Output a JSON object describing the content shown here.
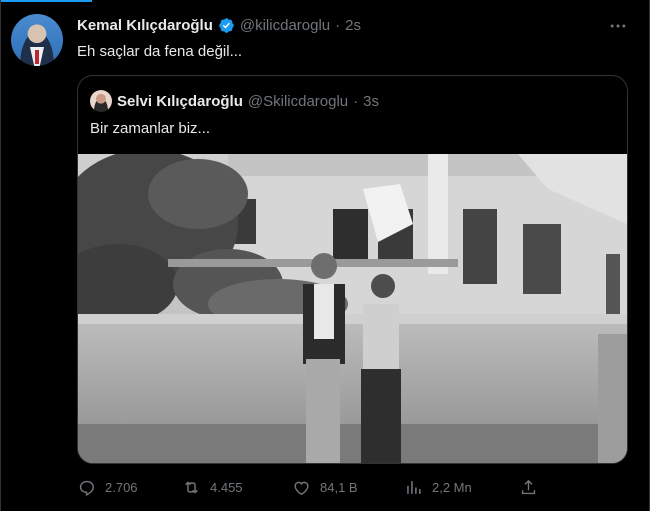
{
  "tweet": {
    "author": {
      "display_name": "Kemal Kılıçdaroğlu",
      "handle": "@kilicdaroglu",
      "verified_icon": "verified-badge-icon"
    },
    "separator": "·",
    "time": "2s",
    "text": "Eh saçlar da fena değil..."
  },
  "more_icon": "more-icon",
  "quote": {
    "author": {
      "display_name": "Selvi Kılıçdaroğlu",
      "handle": "@Skilicdaroglu"
    },
    "separator": "·",
    "time": "3s",
    "text": "Bir zamanlar biz..."
  },
  "actions": {
    "replies": "2.706",
    "retweets": "4.455",
    "likes": "84,1 B",
    "views": "2,2 Mn"
  },
  "colors": {
    "accent": "#1d9bf0",
    "text": "#e7e9ea",
    "muted": "#71767b",
    "border": "#2f3336",
    "background": "#000000"
  }
}
